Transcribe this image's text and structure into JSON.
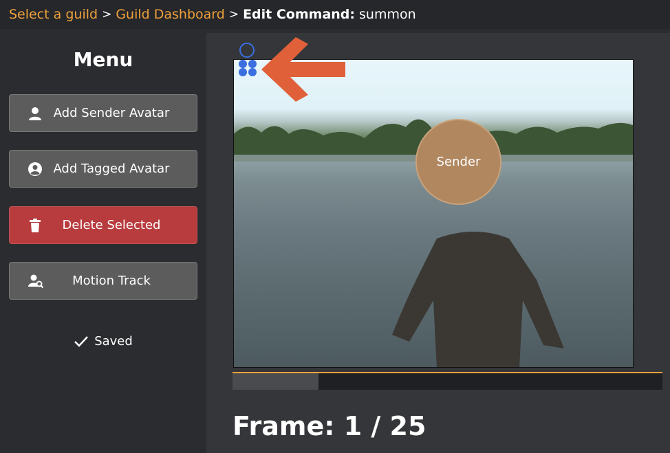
{
  "breadcrumb": {
    "guild_select": "Select a guild",
    "separator": ">",
    "dashboard": "Guild Dashboard",
    "edit_label": "Edit Command:",
    "command_name": "summon"
  },
  "sidebar": {
    "title": "Menu",
    "buttons": [
      {
        "label": "Add Sender Avatar",
        "icon": "user-icon"
      },
      {
        "label": "Add Tagged Avatar",
        "icon": "user-circle-icon"
      },
      {
        "label": "Delete Selected",
        "icon": "trash-icon"
      },
      {
        "label": "Motion Track",
        "icon": "user-search-icon"
      }
    ],
    "status": "Saved"
  },
  "editor": {
    "avatar_label": "Sender",
    "frame_prefix": "Frame:",
    "frame_current": "1",
    "frame_total": "25",
    "frame_text": "1 / 25",
    "progress": 0.2
  },
  "colors": {
    "accent": "#f0a13c",
    "danger": "#b83b3d",
    "button": "#5c5c5c",
    "avatar": "#b0875f",
    "arrow": "#e0603a",
    "handle": "#3b6fe0"
  }
}
